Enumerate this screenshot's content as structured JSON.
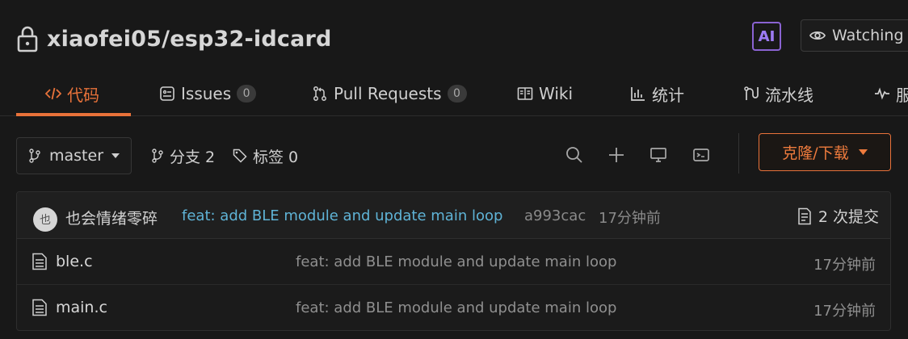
{
  "repo": {
    "owner": "xiaofei05",
    "separator": "/",
    "name": "esp32-idcard",
    "ai_badge": "AI",
    "watch_label": "Watching"
  },
  "tabs": [
    {
      "label": "代码",
      "icon": "code-icon",
      "active": true
    },
    {
      "label": "Issues",
      "icon": "issues-icon",
      "count": "0"
    },
    {
      "label": "Pull Requests",
      "icon": "pull-request-icon",
      "count": "0"
    },
    {
      "label": "Wiki",
      "icon": "book-icon"
    },
    {
      "label": "统计",
      "icon": "bar-chart-icon"
    },
    {
      "label": "流水线",
      "icon": "pipeline-icon"
    },
    {
      "label": "服",
      "icon": "pulse-icon"
    }
  ],
  "toolbar": {
    "branch": "master",
    "branches_label": "分支 2",
    "tags_label": "标签 0",
    "clone_label": "克隆/下载"
  },
  "latest_commit": {
    "avatar_text": "也",
    "author": "也会情绪零碎",
    "message": "feat: add BLE module and update main loop",
    "hash": "a993cac",
    "time": "17分钟前",
    "commit_count_label": "2 次提交"
  },
  "files": [
    {
      "name": "ble.c",
      "commit": "feat: add BLE module and update main loop",
      "time": "17分钟前"
    },
    {
      "name": "main.c",
      "commit": "feat: add BLE module and update main loop",
      "time": "17分钟前"
    }
  ],
  "colors": {
    "accent": "#e8723a",
    "link": "#5fb3d6",
    "background": "#181818"
  }
}
